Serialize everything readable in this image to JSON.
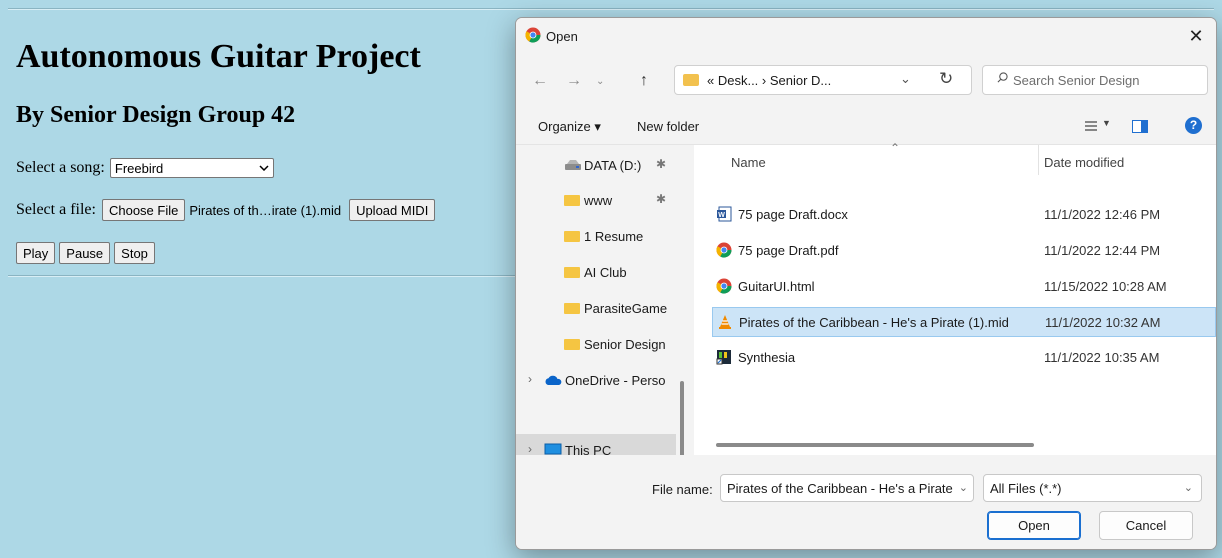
{
  "page": {
    "title": "Autonomous Guitar Project",
    "subtitle": "By Senior Design Group 42",
    "song_label": "Select a song:",
    "song_selected": "Freebird",
    "file_label": "Select a file:",
    "choose_file_label": "Choose File",
    "chosen_file": "Pirates of th…irate (1).mid",
    "upload_label": "Upload MIDI",
    "play_label": "Play",
    "pause_label": "Pause",
    "stop_label": "Stop",
    "background_color": "#add8e6"
  },
  "dialog": {
    "title": "Open",
    "close_glyph": "✕",
    "breadcrumb": "« Desk...  ›  Senior D...",
    "search_placeholder": "Search Senior Design",
    "organize_label": "Organize ▾",
    "new_folder_label": "New folder",
    "nav_items": [
      {
        "label": "DATA (D:)",
        "icon": "drive-icon",
        "pinned": true
      },
      {
        "label": "www",
        "icon": "folder-icon",
        "pinned": true
      },
      {
        "label": "1 Resume",
        "icon": "folder-icon"
      },
      {
        "label": "AI Club",
        "icon": "folder-icon"
      },
      {
        "label": "ParasiteGame",
        "icon": "folder-icon"
      },
      {
        "label": "Senior Design",
        "icon": "folder-icon"
      },
      {
        "label": "OneDrive - Perso",
        "icon": "onedrive-icon"
      },
      {
        "label": "This PC",
        "icon": "monitor-icon",
        "selected": true
      }
    ],
    "columns": {
      "name": "Name",
      "date": "Date modified"
    },
    "files": [
      {
        "name": "75 page Draft.docx",
        "date": "11/1/2022 12:46 PM",
        "icon": "word-icon"
      },
      {
        "name": "75 page Draft.pdf",
        "date": "11/1/2022 12:44 PM",
        "icon": "chrome-icon"
      },
      {
        "name": "GuitarUI.html",
        "date": "11/15/2022 10:28 AM",
        "icon": "chrome-icon"
      },
      {
        "name": "Pirates of the Caribbean - He's a Pirate (1).mid",
        "date": "11/1/2022 10:32 AM",
        "icon": "vlc-icon",
        "selected": true
      },
      {
        "name": "Synthesia",
        "date": "11/1/2022 10:35 AM",
        "icon": "synthesia-shortcut-icon"
      }
    ],
    "file_name_label": "File name:",
    "file_name_value": "Pirates of the Caribbean - He's a Pirate",
    "file_type": "All Files (*.*)",
    "open_label": "Open",
    "cancel_label": "Cancel",
    "accent_color": "#1a6fd0",
    "selection_color": "#cce4f7"
  }
}
